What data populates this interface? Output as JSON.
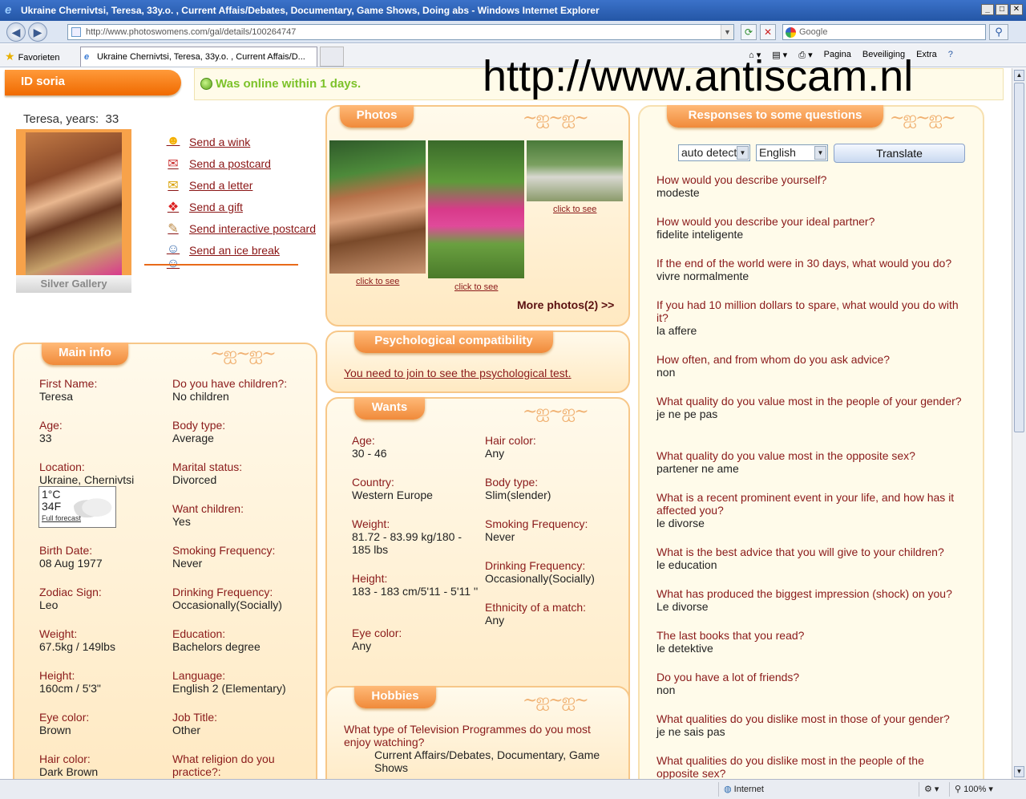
{
  "window": {
    "title": "Ukraine Chernivtsi, Teresa, 33y.o. , Current Affais/Debates, Documentary, Game Shows, Doing abs - Windows Internet Explorer"
  },
  "browser": {
    "url": "http://www.photoswomens.com/gal/details/100264747",
    "search_placeholder": "Google",
    "favorites_label": "Favorieten",
    "tab_title": "Ukraine Chernivtsi, Teresa, 33y.o. , Current Affais/D...",
    "tools": [
      "Pagina",
      "Beveiliging",
      "Extra"
    ],
    "status_zone": "Internet",
    "zoom": "100%"
  },
  "watermark": "http://www.antiscam.nl",
  "profile": {
    "id_label": "ID soria",
    "online_text": "Was online within 1 days.",
    "name_line": "Teresa, years:  33",
    "gallery_label": "Silver Gallery",
    "actions": [
      {
        "label": "Send a wink",
        "icon": "wink-icon",
        "glyph": "☻"
      },
      {
        "label": "Send a postcard",
        "icon": "postcard-icon",
        "glyph": "✉"
      },
      {
        "label": "Send a letter",
        "icon": "letter-icon",
        "glyph": "✉"
      },
      {
        "label": "Send a gift",
        "icon": "gift-icon",
        "glyph": "❖"
      },
      {
        "label": "Send interactive postcard",
        "icon": "interactive-postcard-icon",
        "glyph": "✎"
      },
      {
        "label": "Send an ice break",
        "icon": "ice-break-icon",
        "glyph": "☺"
      }
    ]
  },
  "main_info": {
    "heading": "Main info",
    "left": [
      {
        "label": "First Name:",
        "value": "Teresa"
      },
      {
        "label": "Age:",
        "value": "33"
      },
      {
        "label": "Location:",
        "value": "Ukraine, Chernivtsi"
      },
      {
        "label": "Birth Date:",
        "value": "08 Aug 1977"
      },
      {
        "label": "Zodiac Sign:",
        "value": "Leo"
      },
      {
        "label": "Weight:",
        "value": "67.5kg / 149lbs"
      },
      {
        "label": "Height:",
        "value": "160cm / 5'3\""
      },
      {
        "label": "Eye color:",
        "value": "Brown"
      },
      {
        "label": "Hair color:",
        "value": "Dark Brown"
      }
    ],
    "right": [
      {
        "label": "Do you have children?:",
        "value": "No children"
      },
      {
        "label": "Body type:",
        "value": "Average"
      },
      {
        "label": "Marital status:",
        "value": "Divorced"
      },
      {
        "label": "Want children:",
        "value": "Yes"
      },
      {
        "label": "Smoking Frequency:",
        "value": "Never"
      },
      {
        "label": "Drinking Frequency:",
        "value": "Occasionally(Socially)"
      },
      {
        "label": "Education:",
        "value": "Bachelors degree"
      },
      {
        "label": "Language:",
        "value": "English 2 (Elementary)"
      },
      {
        "label": "Job Title:",
        "value": "Other"
      },
      {
        "label": "What religion do you practice?:",
        "value": ""
      }
    ],
    "weather": {
      "celsius": "1°C",
      "fahrenheit": "34F",
      "link": "Full forecast",
      "icon": "cloud-icon"
    }
  },
  "photos": {
    "heading": "Photos",
    "click_label": "click to see",
    "more": "More photos(2) >>"
  },
  "psych": {
    "heading": "Psychological compatibility",
    "link": "You need to join to see the psychological test."
  },
  "wants": {
    "heading": "Wants",
    "left": [
      {
        "label": "Age:",
        "value": "30 - 46"
      },
      {
        "label": "Country:",
        "value": "Western Europe"
      },
      {
        "label": "Weight:",
        "value": "81.72 - 83.99 kg/180 - 185 lbs"
      },
      {
        "label": "Height:",
        "value": "183 - 183 cm/5'11 - 5'11 ''"
      },
      {
        "label": "Eye color:",
        "value": "Any"
      }
    ],
    "right": [
      {
        "label": "Hair color:",
        "value": "Any"
      },
      {
        "label": "Body type:",
        "value": "Slim(slender)"
      },
      {
        "label": "Smoking Frequency:",
        "value": "Never"
      },
      {
        "label": "Drinking Frequency:",
        "value": "Occasionally(Socially)"
      },
      {
        "label": "Ethnicity of a match:",
        "value": "Any"
      }
    ]
  },
  "hobbies": {
    "heading": "Hobbies",
    "question": "What type of Television Programmes do you most enjoy watching?",
    "answer": "Current Affairs/Debates, Documentary, Game Shows"
  },
  "responses": {
    "heading": "Responses to some questions",
    "source_lang": "auto detect",
    "target_lang": "English",
    "translate_label": "Translate",
    "items": [
      {
        "q": "How would you describe yourself?",
        "a": "modeste"
      },
      {
        "q": "How would you describe your ideal partner?",
        "a": "fidelite inteligente"
      },
      {
        "q": "If the end of the world were in 30 days, what would you do?",
        "a": "vivre normalmente"
      },
      {
        "q": "If you had 10 million dollars to spare, what would you do with it?",
        "a": "la affere"
      },
      {
        "q": "How often, and from whom do you ask advice?",
        "a": "non"
      },
      {
        "q": "What quality do you value most in the people of your gender?",
        "a": "je ne pe pas"
      },
      {
        "q": "What quality do you value most in the opposite sex?",
        "a": "partener ne ame"
      },
      {
        "q": "What is a recent prominent event in your life, and how has it affected you?",
        "a": "le divorse"
      },
      {
        "q": "What is the best advice that you will give to your children?",
        "a": "le education"
      },
      {
        "q": "What has produced the biggest impression (shock) on you?",
        "a": "Le divorse"
      },
      {
        "q": "The last books that you read?",
        "a": "le detektive"
      },
      {
        "q": "Do you have a lot of friends?",
        "a": "non"
      },
      {
        "q": "What qualities do you dislike most in those of your gender?",
        "a": "je ne sais pas"
      },
      {
        "q": "What qualities do you dislike most in the people of the opposite sex?",
        "a": ""
      }
    ]
  }
}
